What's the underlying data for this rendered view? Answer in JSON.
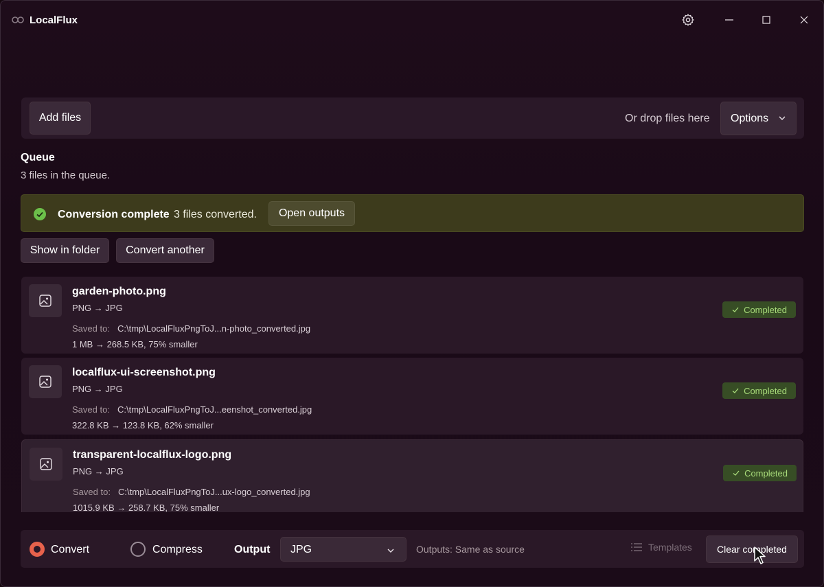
{
  "window": {
    "title": "LocalFlux",
    "controls": [
      "settings-icon",
      "minimize-icon",
      "maximize-icon",
      "close-icon"
    ]
  },
  "dropzone": {
    "add_files_label": "Add files",
    "hint": "Or drop files here",
    "options_label": "Options"
  },
  "queue": {
    "title": "Queue",
    "subtitle": "3 files in the queue."
  },
  "banner": {
    "title": "Conversion complete",
    "message": "3 files converted.",
    "open_outputs_label": "Open outputs",
    "status_color": "#3d3b1c"
  },
  "actions": {
    "show_in_folder": "Show in folder",
    "convert_another": "Convert another"
  },
  "files": [
    {
      "name": "garden-photo.png",
      "conversion": "PNG → JPG",
      "saved_label": "Saved to:",
      "saved_path": "C:\\tmp\\LocalFluxPngToJ...n-photo_converted.jpg",
      "size_info": "1 MB → 268.5 KB, 75% smaller",
      "status": "Completed"
    },
    {
      "name": "localflux-ui-screenshot.png",
      "conversion": "PNG → JPG",
      "saved_label": "Saved to:",
      "saved_path": "C:\\tmp\\LocalFluxPngToJ...eenshot_converted.jpg",
      "size_info": "322.8 KB → 123.8 KB, 62% smaller",
      "status": "Completed"
    },
    {
      "name": "transparent-localflux-logo.png",
      "conversion": "PNG → JPG",
      "saved_label": "Saved to:",
      "saved_path": "C:\\tmp\\LocalFluxPngToJ...ux-logo_converted.jpg",
      "size_info": "1015.9 KB → 258.7 KB, 75% smaller",
      "status": "Completed"
    }
  ],
  "bottombar": {
    "mode_convert": "Convert",
    "mode_compress": "Compress",
    "selected_mode": "Convert",
    "output_label": "Output",
    "output_format": "JPG",
    "outputs_hint": "Outputs: Same as source",
    "templates_label": "Templates",
    "clear_completed_label": "Clear completed"
  },
  "colors": {
    "accent": "#e7624c",
    "success_badge_bg": "#374d25",
    "success_badge_text": "#a8db7a"
  }
}
